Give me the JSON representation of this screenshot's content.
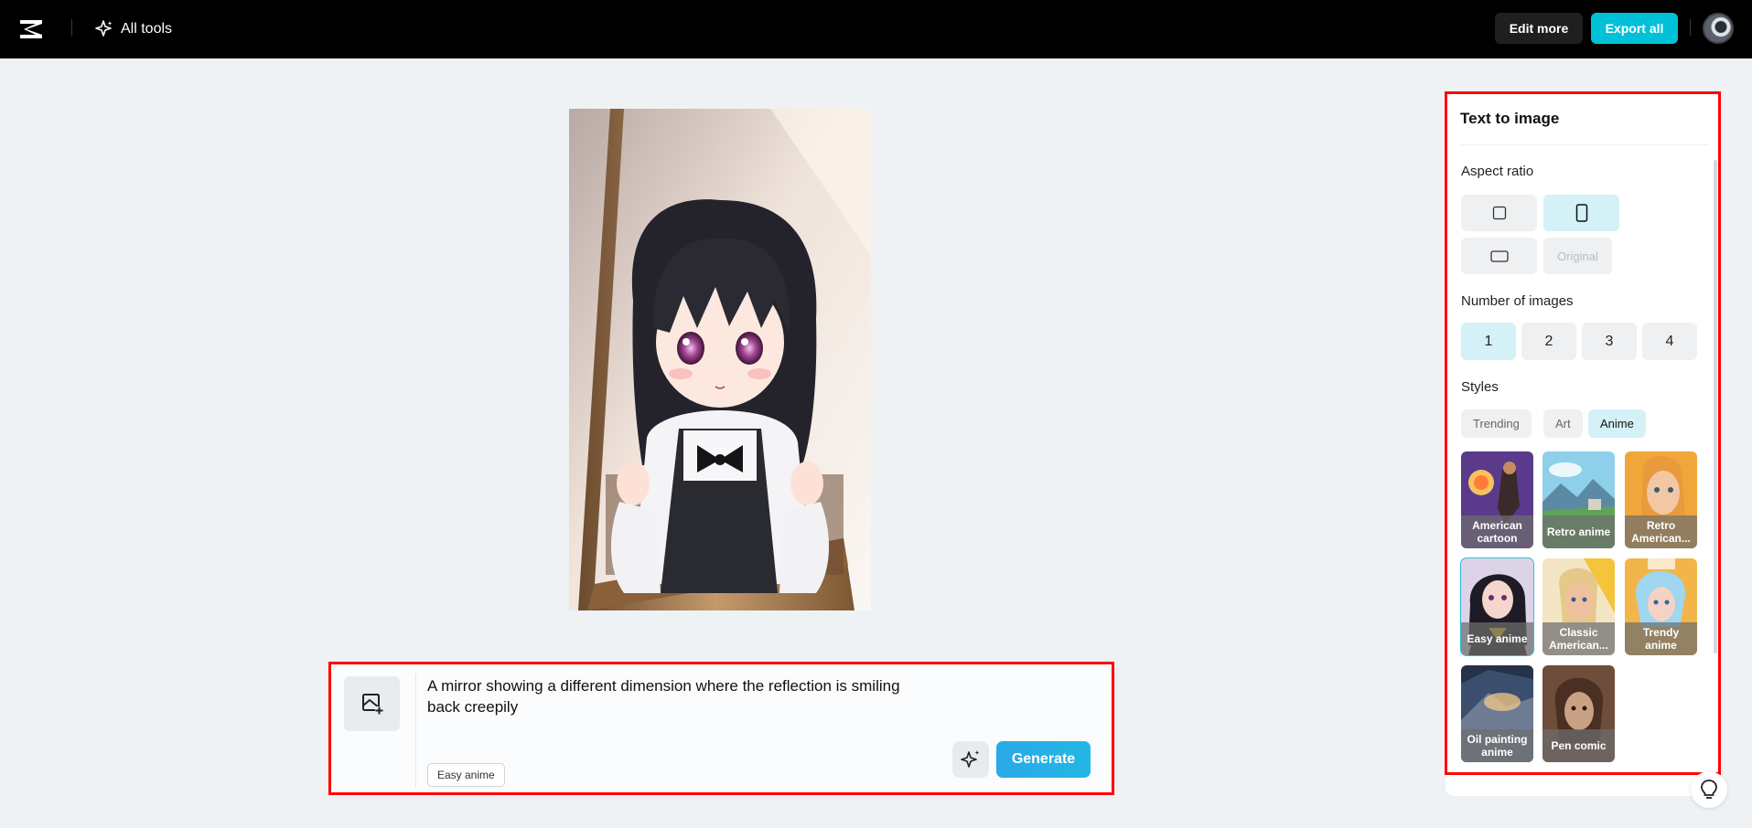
{
  "topbar": {
    "all_tools_label": "All tools",
    "edit_more_label": "Edit more",
    "export_all_label": "Export all"
  },
  "prompt": {
    "text": "A mirror showing a different dimension where the reflection is smiling back creepily",
    "style_chip": "Easy anime",
    "generate_label": "Generate"
  },
  "panel": {
    "title": "Text to image",
    "aspect_ratio_label": "Aspect ratio",
    "aspect_ratios": [
      {
        "id": "square",
        "selected": false
      },
      {
        "id": "portrait",
        "selected": true
      },
      {
        "id": "landscape",
        "selected": false
      },
      {
        "id": "original",
        "label": "Original",
        "selected": false,
        "disabled": true
      }
    ],
    "number_of_images_label": "Number of images",
    "number_options": [
      "1",
      "2",
      "3",
      "4"
    ],
    "number_selected": "1",
    "styles_label": "Styles",
    "style_tabs": [
      "Trending",
      "Art",
      "Anime"
    ],
    "style_tab_selected": "Anime",
    "styles": [
      {
        "name": "American cartoon",
        "selected": false
      },
      {
        "name": "Retro anime",
        "selected": false
      },
      {
        "name": "Retro American...",
        "selected": false
      },
      {
        "name": "Easy anime",
        "selected": true
      },
      {
        "name": "Classic American...",
        "selected": false
      },
      {
        "name": "Trendy anime",
        "selected": false
      },
      {
        "name": "Oil painting anime",
        "selected": false
      },
      {
        "name": "Pen comic",
        "selected": false
      }
    ]
  },
  "colors": {
    "accent": "#00c1d8",
    "selected_bg": "#d3f1f6",
    "highlight_border": "#ff0000"
  }
}
